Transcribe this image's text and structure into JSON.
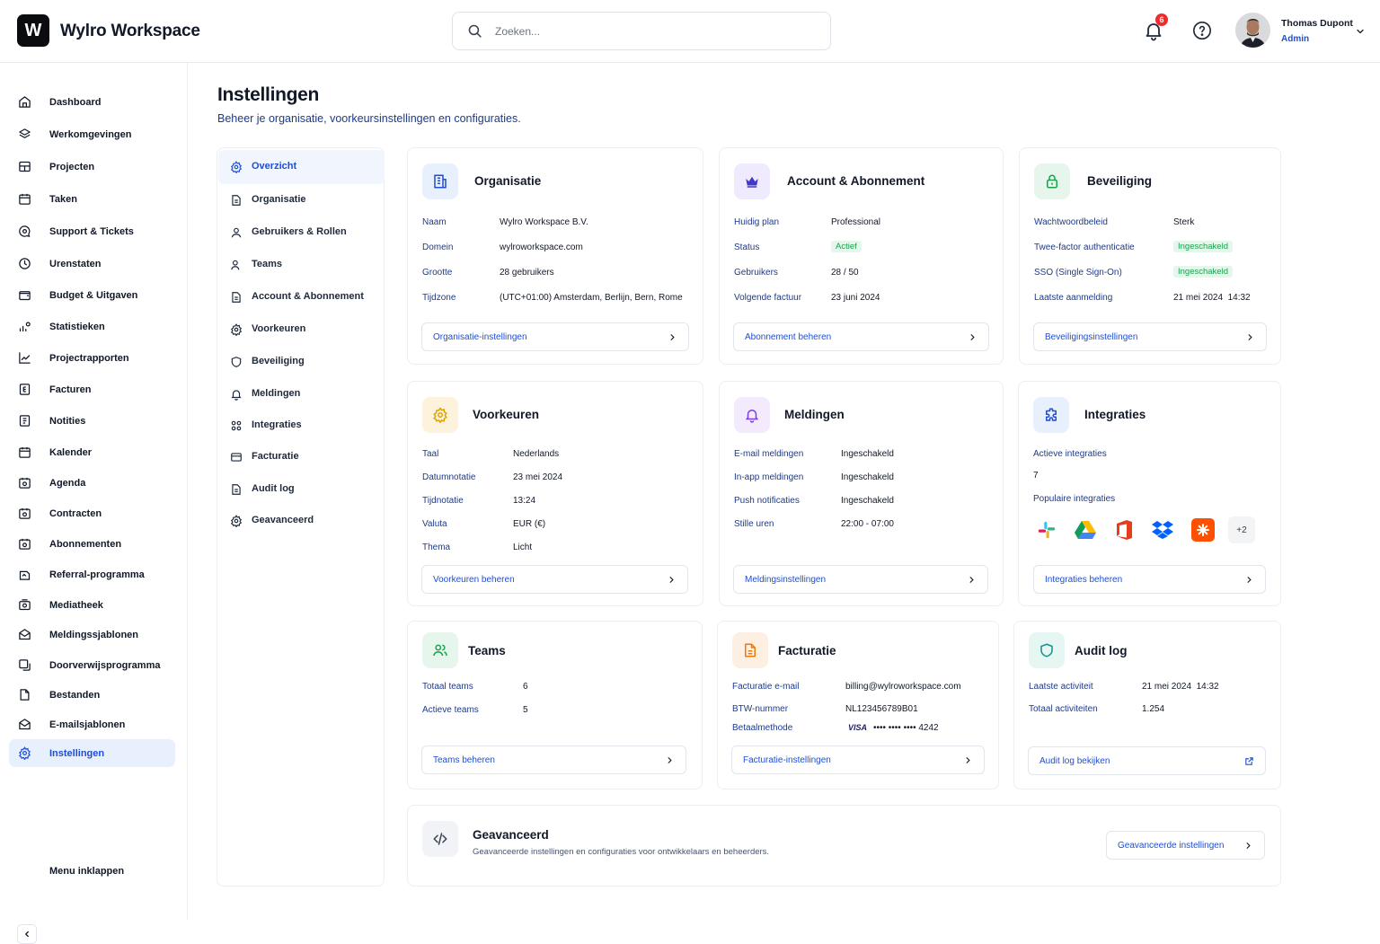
{
  "app": {
    "logo_letter": "W",
    "name": "Wylro Workspace"
  },
  "search": {
    "placeholder": "Zoeken..."
  },
  "notifications": {
    "count": "6"
  },
  "user": {
    "name": "Thomas Dupont",
    "role": "Admin"
  },
  "colors": {
    "accent": "#1d4ed8",
    "badge": "#ef2b2b",
    "success_bg": "#e6f6ec",
    "success_text": "#16a34a"
  },
  "sidebar": {
    "items": [
      {
        "label": "Dashboard",
        "icon": "home-icon"
      },
      {
        "label": "Werkomgevingen",
        "icon": "layers-icon"
      },
      {
        "label": "Projecten",
        "icon": "grid-icon"
      },
      {
        "label": "Taken",
        "icon": "calendar-check-icon"
      },
      {
        "label": "Support & Tickets",
        "icon": "chat-icon"
      },
      {
        "label": "Urenstaten",
        "icon": "clock-icon"
      },
      {
        "label": "Budget & Uitgaven",
        "icon": "wallet-icon"
      },
      {
        "label": "Statistieken",
        "icon": "stats-icon"
      },
      {
        "label": "Projectrapporten",
        "icon": "trend-icon"
      },
      {
        "label": "Facturen",
        "icon": "invoice-icon"
      },
      {
        "label": "Notities",
        "icon": "note-icon"
      },
      {
        "label": "Kalender",
        "icon": "calendar-icon"
      },
      {
        "label": "Agenda",
        "icon": "agenda-icon"
      },
      {
        "label": "Contracten",
        "icon": "contract-icon"
      },
      {
        "label": "Abonnementen",
        "icon": "subscription-icon"
      },
      {
        "label": "Referral-programma",
        "icon": "referral-icon"
      },
      {
        "label": "Mediatheek",
        "icon": "media-icon"
      },
      {
        "label": "Meldingssjablonen",
        "icon": "mail-template-icon"
      },
      {
        "label": "Doorverwijsprogramma",
        "icon": "forward-icon"
      },
      {
        "label": "Bestanden",
        "icon": "file-icon"
      },
      {
        "label": "E-mailsjablonen",
        "icon": "mail-icon"
      },
      {
        "label": "Instellingen",
        "icon": "gear-icon"
      }
    ],
    "collapse_label": "Menu inklappen"
  },
  "page": {
    "title": "Instellingen",
    "subtitle": "Beheer je organisatie, voorkeursinstellingen en configuraties."
  },
  "subnav": {
    "items": [
      {
        "label": "Overzicht",
        "icon": "gear-icon"
      },
      {
        "label": "Organisatie",
        "icon": "document-icon"
      },
      {
        "label": "Gebruikers & Rollen",
        "icon": "user-icon"
      },
      {
        "label": "Teams",
        "icon": "users-icon"
      },
      {
        "label": "Account & Abonnement",
        "icon": "document-icon"
      },
      {
        "label": "Voorkeuren",
        "icon": "gear-icon"
      },
      {
        "label": "Beveiliging",
        "icon": "shield-icon"
      },
      {
        "label": "Meldingen",
        "icon": "bell-icon"
      },
      {
        "label": "Integraties",
        "icon": "apps-icon"
      },
      {
        "label": "Facturatie",
        "icon": "card-icon"
      },
      {
        "label": "Audit log",
        "icon": "document-icon"
      },
      {
        "label": "Geavanceerd",
        "icon": "gear-icon"
      }
    ]
  },
  "cards": {
    "organisatie": {
      "title": "Organisatie",
      "rows": [
        {
          "k": "Naam",
          "v": "Wylro Workspace B.V."
        },
        {
          "k": "Domein",
          "v": "wylroworkspace.com"
        },
        {
          "k": "Grootte",
          "v": "28 gebruikers"
        },
        {
          "k": "Tijdzone",
          "v": "(UTC+01:00) Amsterdam, Berlijn, Bern, Rome"
        }
      ],
      "button": "Organisatie-instellingen"
    },
    "account": {
      "title": "Account & Abonnement",
      "rows": [
        {
          "k": "Huidig plan",
          "v": "Professional"
        },
        {
          "k": "Status",
          "v": "Actief"
        },
        {
          "k": "Gebruikers",
          "v": "28 / 50"
        },
        {
          "k": "Volgende factuur",
          "v": "23 juni 2024"
        }
      ],
      "button": "Abonnement beheren"
    },
    "beveiliging": {
      "title": "Beveiliging",
      "rows": [
        {
          "k": "Wachtwoordbeleid",
          "v": "Sterk"
        },
        {
          "k": "Twee-factor authenticatie",
          "v": "Ingeschakeld"
        },
        {
          "k": "SSO (Single Sign-On)",
          "v": "Ingeschakeld"
        },
        {
          "k": "Laatste aanmelding",
          "v": "21 mei 2024  14:32"
        }
      ],
      "button": "Beveiligingsinstellingen"
    },
    "voorkeuren": {
      "title": "Voorkeuren",
      "rows": [
        {
          "k": "Taal",
          "v": "Nederlands"
        },
        {
          "k": "Datumnotatie",
          "v": "23 mei 2024"
        },
        {
          "k": "Tijdnotatie",
          "v": "13:24"
        },
        {
          "k": "Valuta",
          "v": "EUR (€)"
        },
        {
          "k": "Thema",
          "v": "Licht"
        }
      ],
      "button": "Voorkeuren beheren"
    },
    "meldingen": {
      "title": "Meldingen",
      "rows": [
        {
          "k": "E-mail meldingen",
          "v": "Ingeschakeld"
        },
        {
          "k": "In-app meldingen",
          "v": "Ingeschakeld"
        },
        {
          "k": "Push notificaties",
          "v": "Ingeschakeld"
        },
        {
          "k": "Stille uren",
          "v": "22:00 - 07:00"
        }
      ],
      "button": "Meldingsinstellingen"
    },
    "integraties": {
      "title": "Integraties",
      "active_label": "Actieve integraties",
      "active_count": "7",
      "popular_label": "Populaire integraties",
      "logos": [
        "slack-icon",
        "google-drive-icon",
        "office-icon",
        "dropbox-icon",
        "zapier-icon"
      ],
      "more": "+2",
      "button": "Integraties beheren"
    },
    "teams": {
      "title": "Teams",
      "rows": [
        {
          "k": "Totaal teams",
          "v": "6"
        },
        {
          "k": "Actieve teams",
          "v": "5"
        }
      ],
      "button": "Teams beheren"
    },
    "facturatie": {
      "title": "Facturatie",
      "rows": [
        {
          "k": "Facturatie e-mail",
          "v": "billing@wylroworkspace.com"
        },
        {
          "k": "BTW-nummer",
          "v": "NL123456789B01"
        },
        {
          "k": "Betaalmethode",
          "v": "•••• •••• •••• 4242"
        }
      ],
      "card_brand": "VISA",
      "button": "Facturatie-instellingen"
    },
    "audit": {
      "title": "Audit log",
      "rows": [
        {
          "k": "Laatste activiteit",
          "v": "21 mei 2024  14:32"
        },
        {
          "k": "Totaal activiteiten",
          "v": "1.254"
        }
      ],
      "button": "Audit log bekijken"
    },
    "geavanceerd": {
      "title": "Geavanceerd",
      "description": "Geavanceerde instellingen en configuraties voor ontwikkelaars en beheerders.",
      "button": "Geavanceerde instellingen"
    }
  }
}
